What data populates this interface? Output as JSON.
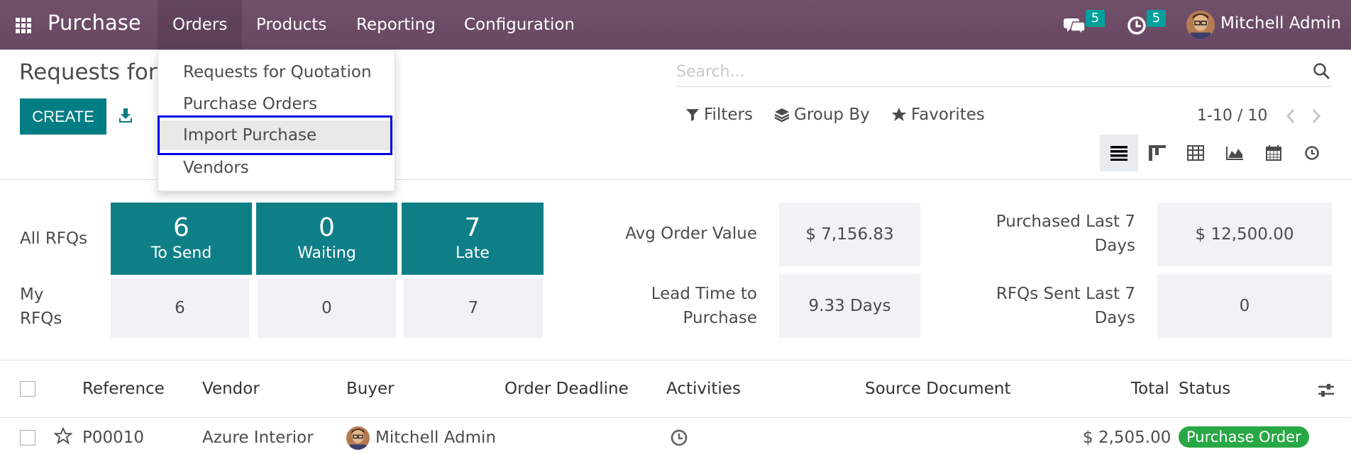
{
  "navbar": {
    "app_name": "Purchase",
    "menus": [
      "Orders",
      "Products",
      "Reporting",
      "Configuration"
    ],
    "messages_count": "5",
    "activities_count": "5",
    "user_name": "Mitchell Admin"
  },
  "orders_menu": {
    "items": [
      "Requests for Quotation",
      "Purchase Orders",
      "Import Purchase",
      "Vendors"
    ],
    "highlighted": "Import Purchase"
  },
  "control_panel": {
    "title": "Requests for Quotation",
    "create_label": "CREATE",
    "search_placeholder": "Search...",
    "filters_label": "Filters",
    "group_by_label": "Group By",
    "favorites_label": "Favorites",
    "pager": "1-10 / 10",
    "views": [
      "list",
      "kanban",
      "pivot",
      "graph",
      "calendar",
      "activity"
    ],
    "active_view": "list"
  },
  "dashboard": {
    "all_rfqs_label": "All RFQs",
    "my_rfqs_label": "My RFQs",
    "my_rfqs_line1": "My",
    "my_rfqs_line2": "RFQs",
    "tiles": [
      {
        "value": "6",
        "label": "To Send"
      },
      {
        "value": "0",
        "label": "Waiting"
      },
      {
        "value": "7",
        "label": "Late"
      }
    ],
    "my_values": [
      "6",
      "0",
      "7"
    ],
    "kpis": {
      "avg_order_value_label": "Avg Order Value",
      "avg_order_value": "$ 7,156.83",
      "lead_time_label_1": "Lead Time to",
      "lead_time_label_2": "Purchase",
      "lead_time": "9.33 Days",
      "purchased_label_1": "Purchased Last 7",
      "purchased_label_2": "Days",
      "purchased": "$ 12,500.00",
      "rfqs_sent_label_1": "RFQs Sent Last 7",
      "rfqs_sent_label_2": "Days",
      "rfqs_sent": "0"
    }
  },
  "list": {
    "columns": [
      "Reference",
      "Vendor",
      "Buyer",
      "Order Deadline",
      "Activities",
      "Source Document",
      "Total",
      "Status"
    ],
    "rows": [
      {
        "reference": "P00010",
        "vendor": "Azure Interior",
        "buyer": "Mitchell Admin",
        "order_deadline": "",
        "source_document": "",
        "total": "$ 2,505.00",
        "status": "Purchase Order"
      }
    ]
  },
  "colors": {
    "navbar": "#6b4a64",
    "primary": "#017e84",
    "tile": "#0f7f87",
    "badge": "#00a09d",
    "highlight_border": "#0000e6",
    "status_green": "#28a745"
  }
}
